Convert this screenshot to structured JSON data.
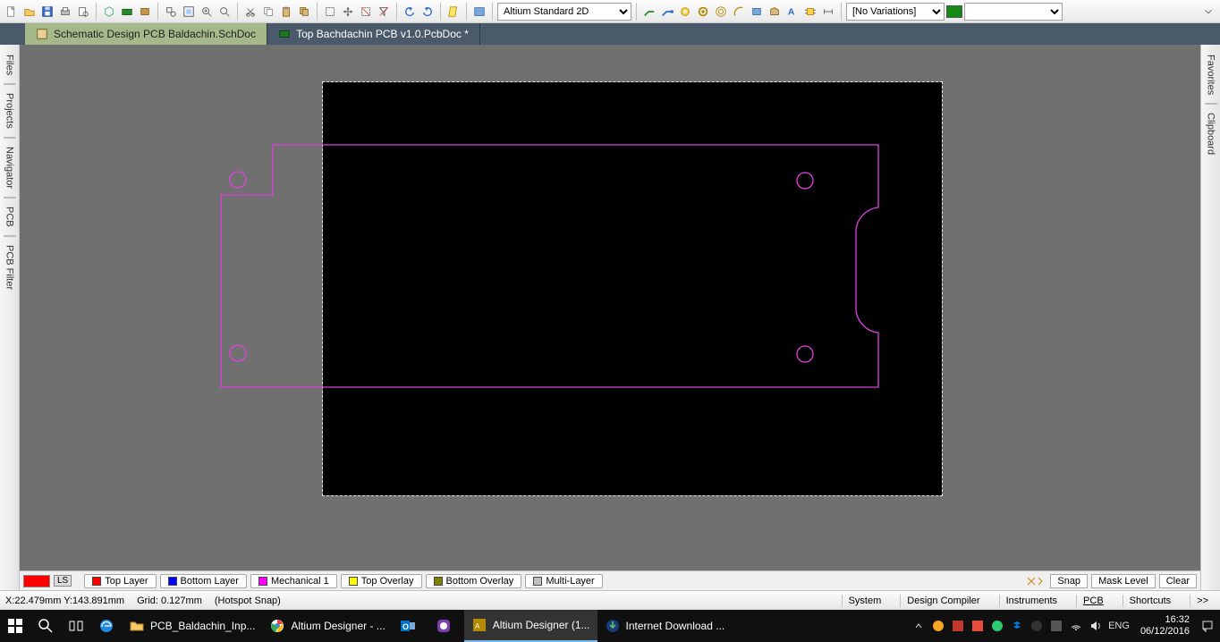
{
  "toolbar": {
    "view_mode": "Altium Standard 2D",
    "variation": "[No Variations]"
  },
  "document_tabs": [
    {
      "label": "Schematic Design PCB Baldachin.SchDoc",
      "active": false
    },
    {
      "label": "Top Bachdachin PCB v1.0.PcbDoc *",
      "active": true
    }
  ],
  "left_panels": [
    "Files",
    "Projects",
    "Navigator",
    "PCB",
    "PCB Filter"
  ],
  "right_panels": [
    "Favorites",
    "Clipboard"
  ],
  "layers": {
    "current_swatch": "#ff0000",
    "ls_label": "LS",
    "tabs": [
      {
        "label": "Top Layer",
        "color": "#ff0000"
      },
      {
        "label": "Bottom Layer",
        "color": "#0000ff"
      },
      {
        "label": "Mechanical 1",
        "color": "#ff00ff"
      },
      {
        "label": "Top Overlay",
        "color": "#ffff00"
      },
      {
        "label": "Bottom Overlay",
        "color": "#808000"
      },
      {
        "label": "Multi-Layer",
        "color": "#c0c0c0"
      }
    ],
    "right_buttons": {
      "snap": "Snap",
      "mask": "Mask Level",
      "clear": "Clear"
    }
  },
  "status": {
    "coords": "X:22.479mm Y:143.891mm",
    "grid": "Grid: 0.127mm",
    "snap": "(Hotspot Snap)",
    "buttons": [
      "System",
      "Design Compiler",
      "Instruments",
      "PCB",
      "Shortcuts",
      ">>"
    ]
  },
  "taskbar": {
    "items": [
      {
        "label": "PCB_Baldachin_Inp...",
        "icon": "folder"
      },
      {
        "label": "Altium Designer - ...",
        "icon": "chrome"
      },
      {
        "label": "",
        "icon": "outlook"
      },
      {
        "label": "",
        "icon": "viber"
      },
      {
        "label": "Altium Designer (1...",
        "icon": "altium",
        "active": true
      },
      {
        "label": "Internet Download ...",
        "icon": "idm"
      }
    ],
    "lang": "ENG",
    "time": "16:32",
    "date": "06/12/2016"
  }
}
